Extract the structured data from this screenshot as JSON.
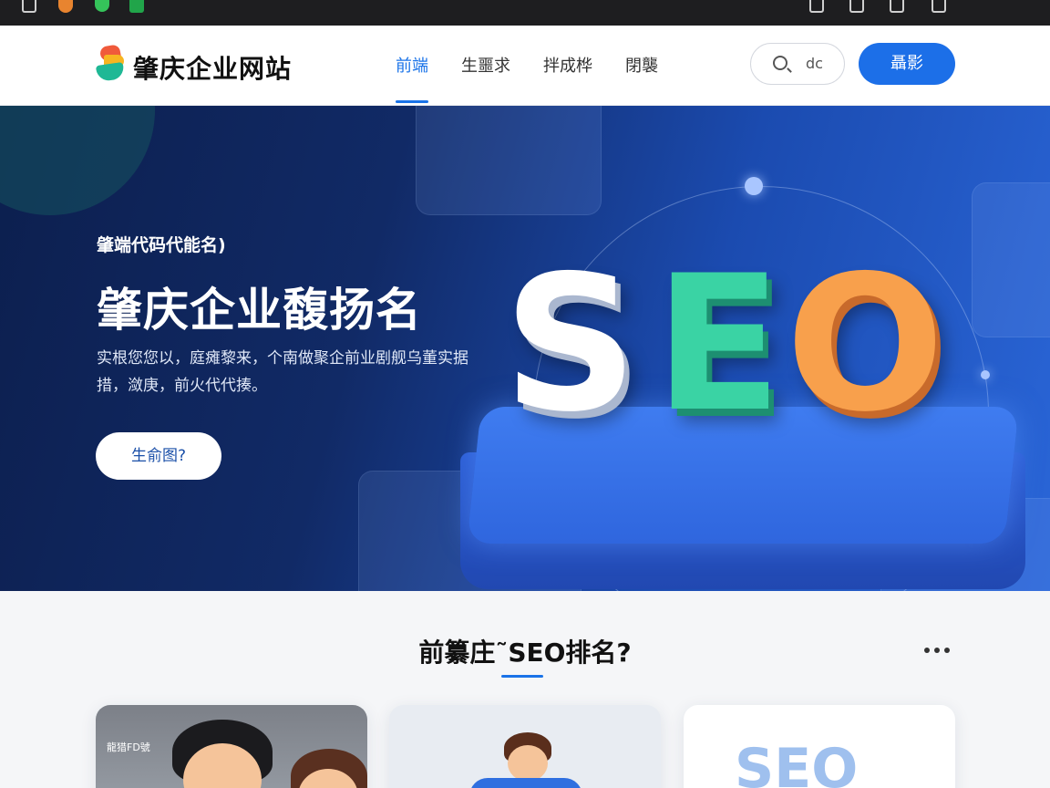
{
  "browser": {
    "top_icons_left": [
      "document-icon",
      "shield-icon",
      "heart-icon",
      "box-icon"
    ],
    "top_icons_right": [
      "document-icon",
      "edit-icon",
      "monitor-icon",
      "refresh-icon"
    ]
  },
  "header": {
    "brand": "肇庆企业网站",
    "nav": [
      {
        "label": "前端",
        "active": true
      },
      {
        "label": "生噩求",
        "active": false
      },
      {
        "label": "拌成桦",
        "active": false
      },
      {
        "label": "閉襲",
        "active": false
      }
    ],
    "search": {
      "text": "dc"
    },
    "cta_label": "聶影",
    "accent": "#1a73e8"
  },
  "hero": {
    "kicker": "肇端代码代能名)",
    "title": "肇庆企业馥扬名",
    "description": "实根您您以，庭瘫黎来，个南做聚企前业剧舰乌董实据措，潋庚，前火代代揍。",
    "button_label": "生俞图?",
    "seo_letters": [
      "S",
      "E",
      "O"
    ],
    "seo_colors": [
      "#ffffff",
      "#3ad3a4",
      "#f8a04c"
    ]
  },
  "section": {
    "title": "前纂庄˜SEO排名?",
    "cards": [
      {
        "caption": "龍猎FD號"
      },
      {
        "caption": ""
      },
      {
        "caption": "SEO"
      }
    ]
  }
}
